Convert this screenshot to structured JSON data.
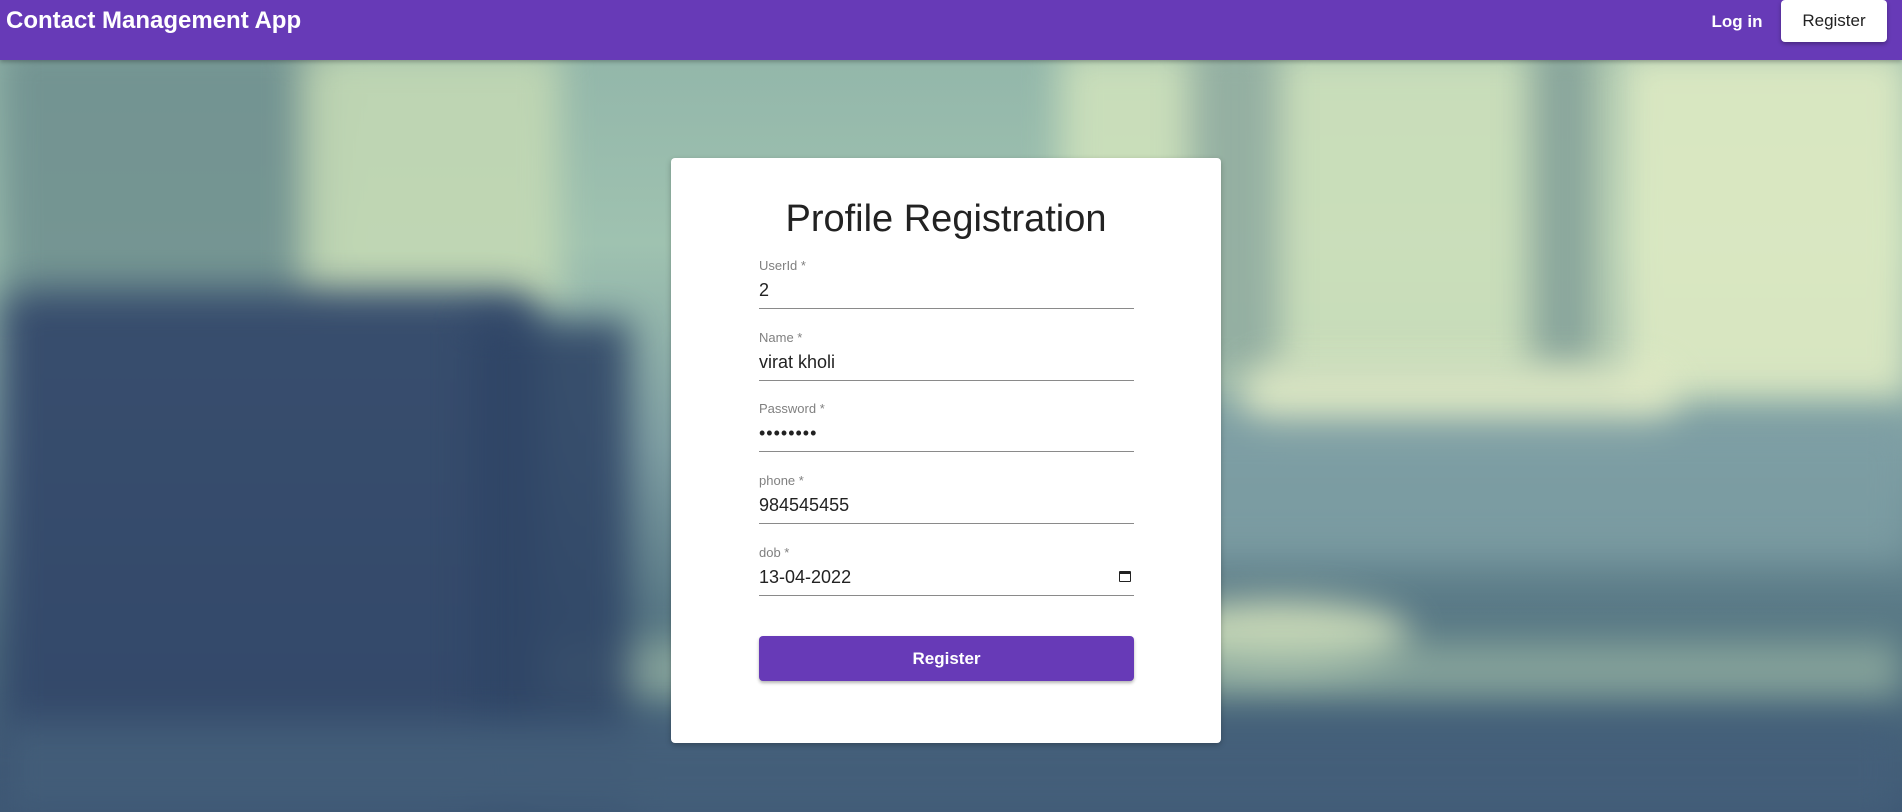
{
  "appbar": {
    "title": "Contact Management App",
    "login_label": "Log in",
    "register_label": "Register",
    "color": "#673ab7"
  },
  "form": {
    "title": "Profile Registration",
    "fields": [
      {
        "label": "UserId *",
        "value": "2"
      },
      {
        "label": "Name *",
        "value": "virat kholi"
      },
      {
        "label": "Password *",
        "value": "••••••••"
      },
      {
        "label": "phone *",
        "value": "984545455"
      },
      {
        "label": "dob *",
        "value": "13-04-2022",
        "icon": "calendar-icon"
      }
    ],
    "submit_label": "Register"
  }
}
